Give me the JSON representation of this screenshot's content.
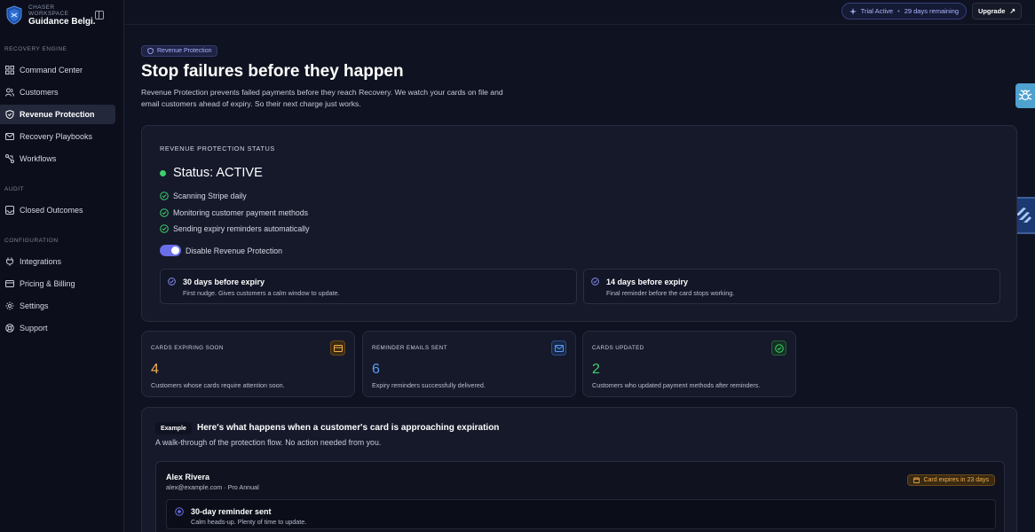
{
  "workspace": {
    "label": "CHASER WORKSPACE",
    "name": "Guidance Belgi..."
  },
  "sidebar": {
    "sections": [
      {
        "title": "RECOVERY ENGINE",
        "items": [
          {
            "label": "Command Center",
            "icon": "grid-icon"
          },
          {
            "label": "Customers",
            "icon": "users-icon"
          },
          {
            "label": "Revenue Protection",
            "icon": "shield-icon",
            "active": true
          },
          {
            "label": "Recovery Playbooks",
            "icon": "mail-icon"
          },
          {
            "label": "Workflows",
            "icon": "workflow-icon"
          }
        ]
      },
      {
        "title": "AUDIT",
        "items": [
          {
            "label": "Closed Outcomes",
            "icon": "inbox-icon"
          }
        ]
      },
      {
        "title": "CONFIGURATION",
        "items": [
          {
            "label": "Integrations",
            "icon": "plug-icon"
          },
          {
            "label": "Pricing & Billing",
            "icon": "card-icon"
          },
          {
            "label": "Settings",
            "icon": "gear-icon"
          },
          {
            "label": "Support",
            "icon": "lifebuoy-icon"
          }
        ]
      }
    ]
  },
  "topbar": {
    "trial_label": "Trial Active",
    "trial_sep": "•",
    "trial_remaining": "29 days remaining",
    "upgrade_label": "Upgrade",
    "upgrade_arrow": "↗"
  },
  "page": {
    "pill": "Revenue Protection",
    "title": "Stop failures before they happen",
    "description": "Revenue Protection prevents failed payments before they reach Recovery. We watch your cards on file and email customers ahead of expiry. So their next charge just works."
  },
  "status": {
    "heading": "REVENUE PROTECTION STATUS",
    "status_text": "Status: ACTIVE",
    "checks": [
      "Scanning Stripe daily",
      "Monitoring customer payment methods",
      "Sending expiry reminders automatically"
    ],
    "toggle_label": "Disable Revenue Protection",
    "toggle_on": true,
    "reminders": [
      {
        "title": "30 days before expiry",
        "subtitle": "First nudge. Gives customers a calm window to update."
      },
      {
        "title": "14 days before expiry",
        "subtitle": "Final reminder before the card stops working."
      }
    ]
  },
  "stats": [
    {
      "label": "CARDS EXPIRING SOON",
      "value": "4",
      "desc": "Customers whose cards require attention soon.",
      "icon": "credit-card-icon",
      "color": "#f2b04d"
    },
    {
      "label": "REMINDER EMAILS SENT",
      "value": "6",
      "desc": "Expiry reminders successfully delivered.",
      "icon": "mail-icon",
      "color": "#5b9cf0"
    },
    {
      "label": "CARDS UPDATED",
      "value": "2",
      "desc": "Customers who updated payment methods after reminders.",
      "icon": "check-circle-icon",
      "color": "#3ecf6b"
    }
  ],
  "example": {
    "badge": "Example",
    "title": "Here's what happens when a customer's card is approaching expiration",
    "subtitle": "A walk-through of the protection flow. No action needed from you.",
    "customer": {
      "name": "Alex Rivera",
      "email": "alex@example.com · Pro Annual",
      "expires": "Card expires in 23 days"
    },
    "step": {
      "title": "30-day reminder sent",
      "subtitle": "Calm heads-up. Plenty of time to update."
    }
  },
  "colors": {
    "accent": "#6a6ee8",
    "active_green": "#3ecf6b",
    "warning": "#f2b04d",
    "info": "#5b9cf0",
    "background": "#0f1220"
  }
}
